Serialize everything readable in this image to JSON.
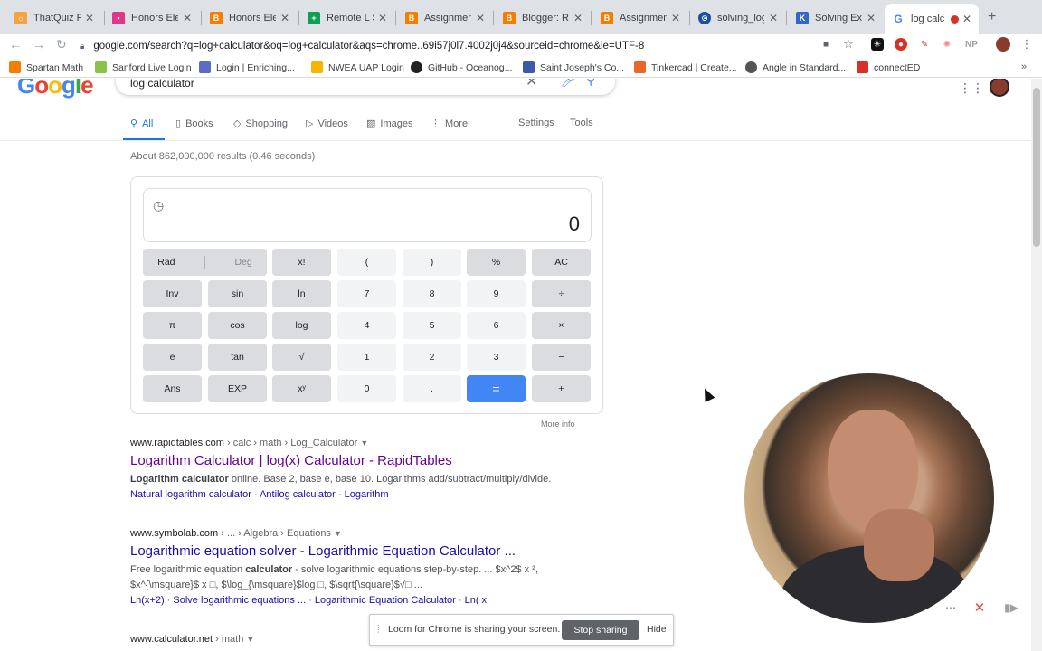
{
  "browser": {
    "tabs": [
      {
        "title": "ThatQuiz Fo",
        "icon": "thatquiz-icon",
        "color": "#f4a340"
      },
      {
        "title": "Honors Elem",
        "icon": "classroom-icon",
        "color": "#e0368a"
      },
      {
        "title": "Honors Elem",
        "icon": "blogger-icon",
        "color": "#f57d00"
      },
      {
        "title": "Remote L Sc",
        "icon": "sheets-icon",
        "color": "#0f9d58"
      },
      {
        "title": "Assignment",
        "icon": "blogger-icon",
        "color": "#f57d00"
      },
      {
        "title": "Blogger: Re",
        "icon": "blogger-icon",
        "color": "#f57d00"
      },
      {
        "title": "Assignment",
        "icon": "blogger-icon",
        "color": "#f57d00"
      },
      {
        "title": "solving_log_",
        "icon": "doc-icon",
        "color": "#1a4fa3"
      },
      {
        "title": "Solving Exp",
        "icon": "k-icon",
        "color": "#3366cc"
      },
      {
        "title": "log calc",
        "icon": "google-icon",
        "color": "#4285f4"
      }
    ],
    "new_tab": "+",
    "url": "google.com/search?q=log+calculator&oq=log+calculator&aqs=chrome..69i57j0l7.4002j0j4&sourceid=chrome&ie=UTF-8",
    "np_badge": "NP",
    "bookmarks": [
      {
        "label": "Spartan Math",
        "color": "#f57d00"
      },
      {
        "label": "Sanford Live Login",
        "color": "#8bc34a"
      },
      {
        "label": "Login | Enriching...",
        "color": "#5b6cc4"
      },
      {
        "label": "NWEA UAP Login",
        "color": "#f2b705"
      },
      {
        "label": "GitHub - Oceanog...",
        "color": "#222222"
      },
      {
        "label": "Saint Joseph's Co...",
        "color": "#3b5ba9"
      },
      {
        "label": "Tinkercad | Create...",
        "color": "#e9672b"
      },
      {
        "label": "Angle in Standard...",
        "color": "#555555"
      },
      {
        "label": "connectED",
        "color": "#d93025"
      }
    ],
    "bookmarks_more": "»"
  },
  "search": {
    "logo": "Google",
    "query": "log calculator",
    "nav_tabs": [
      "All",
      "Books",
      "Shopping",
      "Videos",
      "Images",
      "More"
    ],
    "settings": "Settings",
    "tools": "Tools",
    "stats": "About 862,000,000 results (0.46 seconds)"
  },
  "calculator": {
    "display": "0",
    "rows": [
      [
        "Rad",
        "Deg",
        "x!",
        "(",
        ")",
        "%",
        "AC"
      ],
      [
        "Inv",
        "sin",
        "ln",
        "7",
        "8",
        "9",
        "÷"
      ],
      [
        "π",
        "cos",
        "log",
        "4",
        "5",
        "6",
        "×"
      ],
      [
        "e",
        "tan",
        "√",
        "1",
        "2",
        "3",
        "−"
      ],
      [
        "Ans",
        "EXP",
        "xʸ",
        "0",
        ".",
        "=",
        "+"
      ]
    ],
    "more_info": "More info"
  },
  "results": [
    {
      "site": "www.rapidtables.com",
      "path": " › calc › math › Log_Calculator",
      "title": "Logarithm Calculator | log(x) Calculator - RapidTables",
      "snippet_bold": "Logarithm calculator",
      "snippet": " online. Base 2, base e, base 10. Logarithms add/subtract/multiply/divide.",
      "links": [
        "Natural logarithm calculator",
        "Antilog calculator",
        "Logarithm"
      ]
    },
    {
      "site": "www.symbolab.com",
      "path": " › ... › Algebra › Equations",
      "title": "Logarithmic equation solver - Logarithmic Equation Calculator ...",
      "snippet_pre": "Free logarithmic equation ",
      "snippet_bold": "calculator",
      "snippet": " - solve logarithmic equations step-by-step. ... $x^2$ x ²,",
      "snippet2": "$x^{\\msquare}$ x □, $\\log_{\\msquare}$log □, $\\sqrt{\\square}$√□ ...",
      "links": [
        "Ln(x+2)",
        "Solve logarithmic equations ...",
        "Logarithmic Equation Calculator",
        "Ln( x"
      ]
    },
    {
      "site": "www.calculator.net",
      "path": " › math"
    }
  ],
  "loom": {
    "message": "Loom for Chrome is sharing your screen.",
    "stop": "Stop sharing",
    "hide": "Hide"
  }
}
